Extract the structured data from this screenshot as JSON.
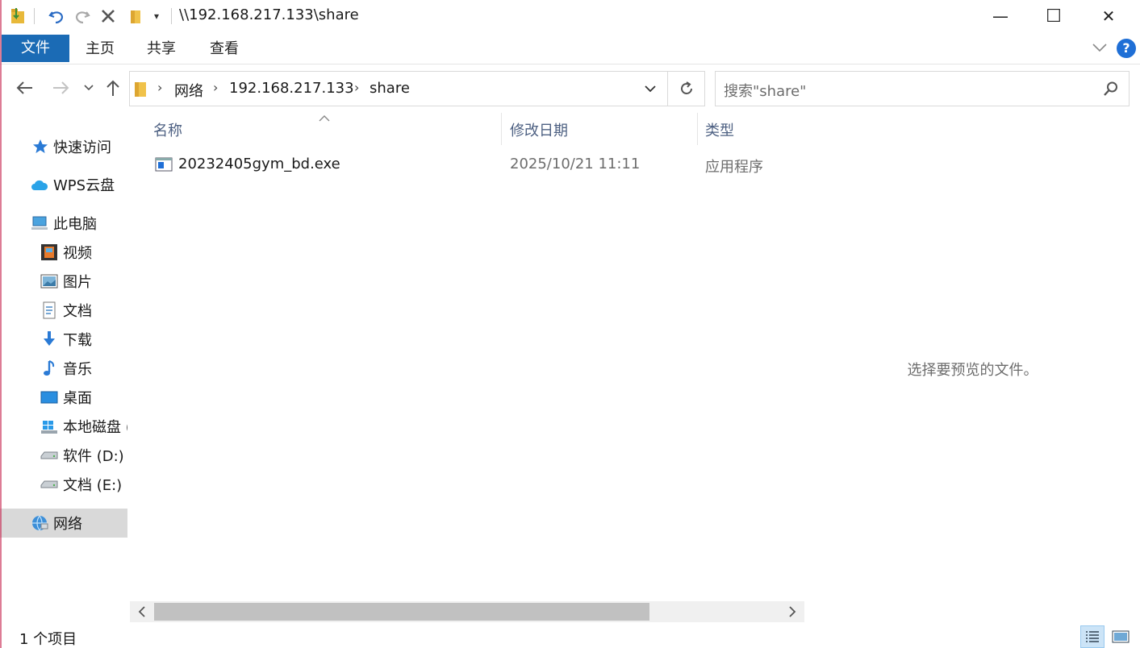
{
  "titlebar": {
    "title": "\\\\192.168.217.133\\share",
    "minimize": "—",
    "maximize": "☐",
    "close": "✕"
  },
  "ribbon": {
    "tabs": [
      "文件",
      "主页",
      "共享",
      "查看"
    ]
  },
  "address": {
    "crumbs": [
      "网络",
      "192.168.217.133",
      "share"
    ]
  },
  "search": {
    "placeholder": "搜索\"share\""
  },
  "sidebar": {
    "items": [
      {
        "label": "快速访问",
        "icon": "star-icon"
      },
      {
        "label": "WPS云盘",
        "icon": "cloud-icon"
      },
      {
        "label": "此电脑",
        "icon": "computer-icon"
      },
      {
        "label": "视频",
        "icon": "video-icon"
      },
      {
        "label": "图片",
        "icon": "pictures-icon"
      },
      {
        "label": "文档",
        "icon": "documents-icon"
      },
      {
        "label": "下载",
        "icon": "download-icon"
      },
      {
        "label": "音乐",
        "icon": "music-icon"
      },
      {
        "label": "桌面",
        "icon": "desktop-icon"
      },
      {
        "label": "本地磁盘 (",
        "icon": "windows-drive-icon"
      },
      {
        "label": "软件 (D:)",
        "icon": "drive-icon"
      },
      {
        "label": "文档 (E:)",
        "icon": "drive-icon"
      },
      {
        "label": "网络",
        "icon": "network-icon"
      }
    ]
  },
  "table": {
    "columns": [
      "名称",
      "修改日期",
      "类型"
    ],
    "rows": [
      {
        "name": "20232405gym_bd.exe",
        "modified": "2025/10/21 11:11",
        "type": "应用程序"
      }
    ]
  },
  "preview": {
    "message": "选择要预览的文件。"
  },
  "status": {
    "count": "1 个项目"
  },
  "colors": {
    "accent": "#1b6bb5",
    "selected": "#d9d9d9",
    "header_text": "#4d6082"
  }
}
